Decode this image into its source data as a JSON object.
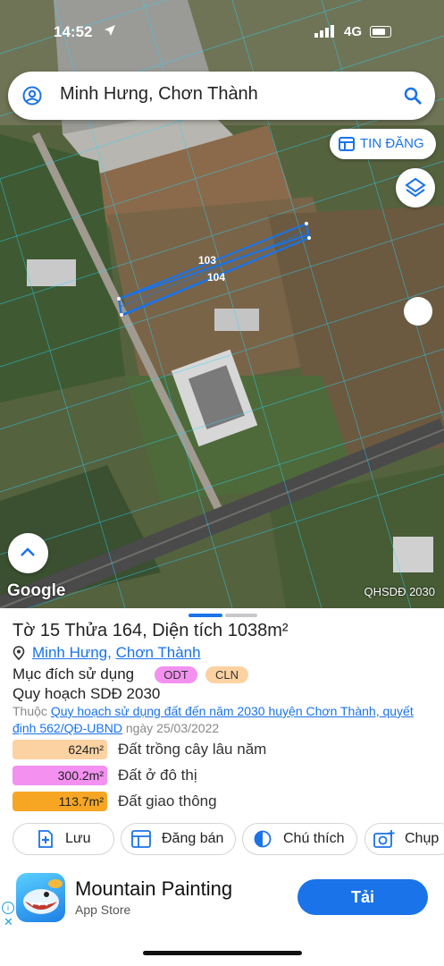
{
  "status_bar": {
    "time": "14:52",
    "network": "4G"
  },
  "search": {
    "title": "Minh Hưng, Chơn Thành"
  },
  "map": {
    "tin_dang_label": "TIN ĐĂNG",
    "plot_labels": [
      "103",
      "104"
    ],
    "attribution": "Google",
    "overlay_label": "QHSDĐ 2030"
  },
  "parcel": {
    "title": "Tờ 15 Thửa 164, Diện tích 1038m²",
    "address_commune": "Minh Hưng",
    "address_sep": ",",
    "address_district": "Chơn Thành",
    "purpose_label": "Mục đích sử dụng",
    "purpose_codes": [
      "ODT",
      "CLN"
    ],
    "plan_label": "Quy hoạch SDĐ 2030",
    "belongs_prefix": "Thuộc",
    "belongs_link": "Quy hoạch sử dụng đất đến năm 2030 huyện Chơn Thành, quyết định 562/QĐ-UBND",
    "belongs_date": "ngày 25/03/2022",
    "areas": [
      {
        "value": "624m²",
        "label": "Đất trồng cây lâu năm",
        "color": "#fcd2a2"
      },
      {
        "value": "300.2m²",
        "label": "Đất ở đô thị",
        "color": "#f390f0"
      },
      {
        "value": "113.7m²",
        "label": "Đất giao thông",
        "color": "#f6a623"
      }
    ],
    "actions": [
      "Lưu",
      "Đăng bán",
      "Chú thích",
      "Chụp"
    ]
  },
  "ad": {
    "title": "Mountain Painting",
    "store": "App Store",
    "cta": "Tải"
  },
  "colors": {
    "accent": "#1a73e8"
  }
}
